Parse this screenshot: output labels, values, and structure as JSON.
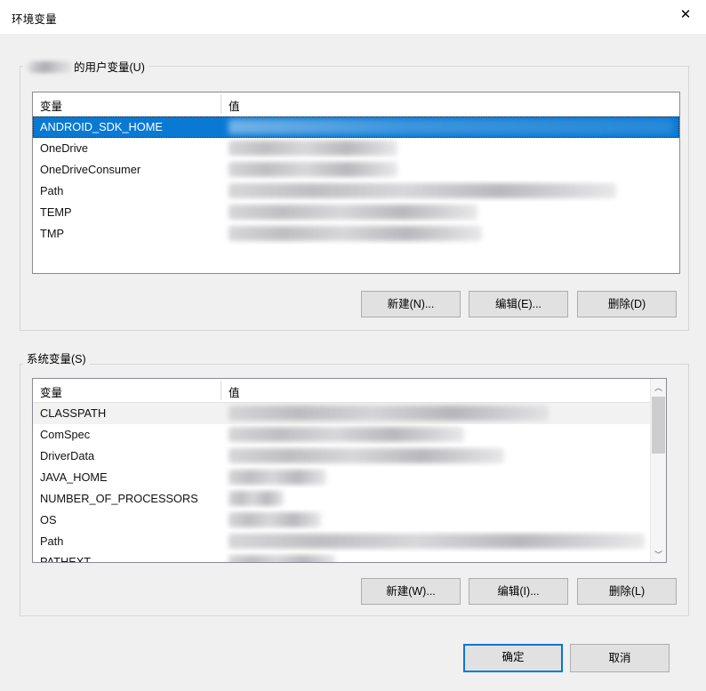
{
  "window": {
    "title": "环境变量",
    "close_icon": "close-icon",
    "close_glyph": "✕"
  },
  "colors": {
    "selection_blue": "#0a79d4",
    "accent_focus": "#0078d7",
    "dialog_bg": "#f0f0f0",
    "list_bg": "#ffffff",
    "list_border": "#8a8a92",
    "button_face": "#e1e1e1",
    "button_border": "#adadad",
    "soft_selection": "#f2f2f2"
  },
  "user_section": {
    "label_suffix": "的用户变量(U)",
    "label_redacted": true,
    "columns": [
      "变量",
      "值"
    ],
    "rows": [
      {
        "name": "ANDROID_SDK_HOME",
        "value": "",
        "redacted": true,
        "selected": true,
        "smear_width": 500
      },
      {
        "name": "OneDrive",
        "value": "",
        "redacted": true,
        "selected": false,
        "smear_width": 190
      },
      {
        "name": "OneDriveConsumer",
        "value": "",
        "redacted": true,
        "selected": false,
        "smear_width": 190
      },
      {
        "name": "Path",
        "value": "",
        "redacted": true,
        "selected": false,
        "smear_width": 436
      },
      {
        "name": "TEMP",
        "value": "",
        "redacted": true,
        "selected": false,
        "smear_width": 280
      },
      {
        "name": "TMP",
        "value": "",
        "redacted": true,
        "selected": false,
        "smear_width": 285
      }
    ],
    "buttons": {
      "new": "新建(N)...",
      "edit": "编辑(E)...",
      "delete": "删除(D)"
    }
  },
  "system_section": {
    "label": "系统变量(S)",
    "columns": [
      "变量",
      "值"
    ],
    "rows": [
      {
        "name": "CLASSPATH",
        "value": "",
        "redacted": true,
        "soft_selected": true,
        "smear_width": 360
      },
      {
        "name": "ComSpec",
        "value": "",
        "redacted": true,
        "soft_selected": false,
        "smear_width": 265
      },
      {
        "name": "DriverData",
        "value": "",
        "redacted": true,
        "soft_selected": false,
        "smear_width": 310
      },
      {
        "name": "JAVA_HOME",
        "value": "",
        "redacted": true,
        "soft_selected": false,
        "smear_width": 110
      },
      {
        "name": "NUMBER_OF_PROCESSORS",
        "value": "",
        "redacted": true,
        "soft_selected": false,
        "smear_width": 62
      },
      {
        "name": "OS",
        "value": "",
        "redacted": true,
        "soft_selected": false,
        "smear_width": 104
      },
      {
        "name": "Path",
        "value": "",
        "redacted": true,
        "soft_selected": false,
        "smear_width": 468
      },
      {
        "name": "PATHEXT",
        "value": ".COM;",
        "redacted": true,
        "soft_selected": false,
        "smear_width": 120,
        "clipped": true
      }
    ],
    "scrollbar": {
      "up_arrow": "chevron-up-icon",
      "down_arrow": "chevron-down-icon",
      "up_glyph": "︿",
      "down_glyph": "﹀"
    },
    "buttons": {
      "new": "新建(W)...",
      "edit": "编辑(I)...",
      "delete": "删除(L)"
    }
  },
  "dialog_buttons": {
    "ok": "确定",
    "cancel": "取消"
  }
}
